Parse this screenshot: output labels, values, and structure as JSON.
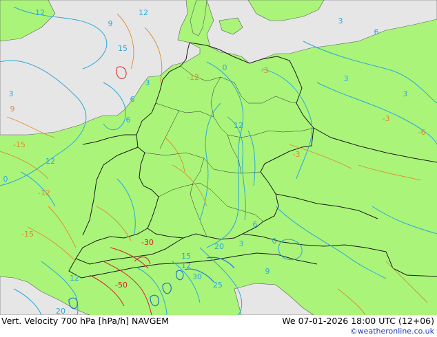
{
  "footer": {
    "title": "Vert. Velocity 700 hPa [hPa/h] NAVGEM",
    "timestamp": "We 07-01-2026 18:00 UTC (12+06)",
    "credit": "©weatheronline.co.uk"
  },
  "colors": {
    "land": "#aaf47a",
    "sea": "#e6e6e6",
    "border": "#1a1a1a",
    "positive_contour": "#2aa7d9",
    "negative_contour": "#e08a2a",
    "strong_negative": "#d92020"
  },
  "contour_labels": [
    {
      "text": "12",
      "color": "#2aa7d9"
    },
    {
      "text": "9",
      "color": "#2aa7d9"
    },
    {
      "text": "12",
      "color": "#2aa7d9"
    },
    {
      "text": "15",
      "color": "#2aa7d9"
    },
    {
      "text": "3",
      "color": "#2aa7d9"
    },
    {
      "text": "6",
      "color": "#2aa7d9"
    },
    {
      "text": "0",
      "color": "#2aa7d9"
    },
    {
      "text": "3",
      "color": "#2aa7d9"
    },
    {
      "text": "-12",
      "color": "#e08a2a"
    },
    {
      "text": "0",
      "color": "#2aa7d9"
    },
    {
      "text": "-3",
      "color": "#e08a2a"
    },
    {
      "text": "9",
      "color": "#e08a2a"
    },
    {
      "text": "6",
      "color": "#2aa7d9"
    },
    {
      "text": "12",
      "color": "#2aa7d9"
    },
    {
      "text": "-15",
      "color": "#e08a2a"
    },
    {
      "text": "12",
      "color": "#2aa7d9"
    },
    {
      "text": "3",
      "color": "#2aa7d9"
    },
    {
      "text": "-12",
      "color": "#e08a2a"
    },
    {
      "text": "-15",
      "color": "#e08a2a"
    },
    {
      "text": "-30",
      "color": "#d92020"
    },
    {
      "text": "-50",
      "color": "#d92020"
    },
    {
      "text": "20",
      "color": "#2aa7d9"
    },
    {
      "text": "30",
      "color": "#2aa7d9"
    },
    {
      "text": "25",
      "color": "#2aa7d9"
    },
    {
      "text": "15",
      "color": "#2aa7d9"
    },
    {
      "text": "12",
      "color": "#2aa7d9"
    },
    {
      "text": "3",
      "color": "#2aa7d9"
    },
    {
      "text": "0",
      "color": "#2aa7d9"
    },
    {
      "text": "-3",
      "color": "#e08a2a"
    },
    {
      "text": "-3",
      "color": "#e08a2a"
    },
    {
      "text": "3",
      "color": "#2aa7d9"
    },
    {
      "text": "6",
      "color": "#2aa7d9"
    },
    {
      "text": "-6",
      "color": "#e08a2a"
    },
    {
      "text": "6",
      "color": "#2aa7d9"
    },
    {
      "text": "9",
      "color": "#2aa7d9"
    },
    {
      "text": "12",
      "color": "#2aa7d9"
    },
    {
      "text": "3",
      "color": "#2aa7d9"
    },
    {
      "text": "20",
      "color": "#2aa7d9"
    }
  ]
}
